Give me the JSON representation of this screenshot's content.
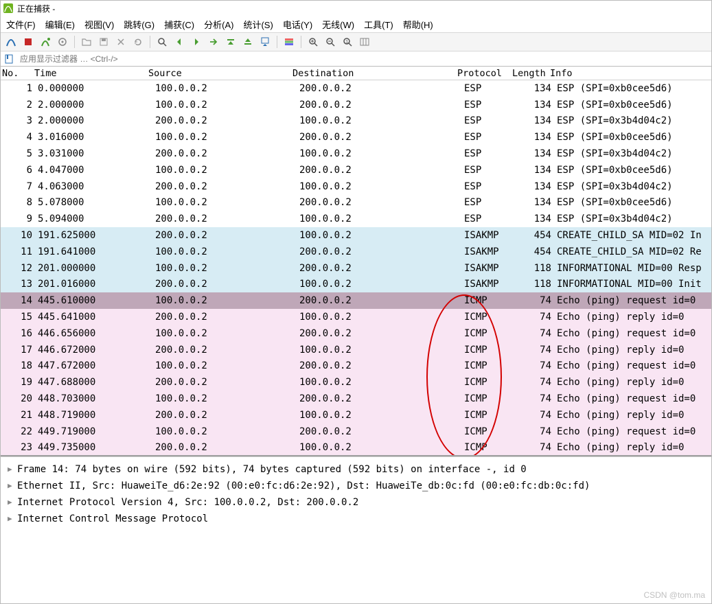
{
  "window": {
    "title": "正在捕获 -"
  },
  "menu": {
    "file": "文件(F)",
    "edit": "编辑(E)",
    "view": "视图(V)",
    "goto": "跳转(G)",
    "capture": "捕获(C)",
    "analyze": "分析(A)",
    "stats": "统计(S)",
    "telephony": "电话(Y)",
    "wireless": "无线(W)",
    "tools": "工具(T)",
    "help": "帮助(H)"
  },
  "filter": {
    "placeholder": "应用显示过滤器 … <Ctrl-/>"
  },
  "columns": {
    "no": "No.",
    "time": "Time",
    "source": "Source",
    "destination": "Destination",
    "protocol": "Protocol",
    "length": "Length",
    "info": "Info"
  },
  "packets": [
    {
      "no": "1",
      "time": "0.000000",
      "src": "100.0.0.2",
      "dst": "200.0.0.2",
      "prot": "ESP",
      "len": "134",
      "info": "ESP (SPI=0xb0cee5d6)",
      "bg": "esp"
    },
    {
      "no": "2",
      "time": "2.000000",
      "src": "100.0.0.2",
      "dst": "200.0.0.2",
      "prot": "ESP",
      "len": "134",
      "info": "ESP (SPI=0xb0cee5d6)",
      "bg": "esp"
    },
    {
      "no": "3",
      "time": "2.000000",
      "src": "200.0.0.2",
      "dst": "100.0.0.2",
      "prot": "ESP",
      "len": "134",
      "info": "ESP (SPI=0x3b4d04c2)",
      "bg": "esp"
    },
    {
      "no": "4",
      "time": "3.016000",
      "src": "100.0.0.2",
      "dst": "200.0.0.2",
      "prot": "ESP",
      "len": "134",
      "info": "ESP (SPI=0xb0cee5d6)",
      "bg": "esp"
    },
    {
      "no": "5",
      "time": "3.031000",
      "src": "200.0.0.2",
      "dst": "100.0.0.2",
      "prot": "ESP",
      "len": "134",
      "info": "ESP (SPI=0x3b4d04c2)",
      "bg": "esp"
    },
    {
      "no": "6",
      "time": "4.047000",
      "src": "100.0.0.2",
      "dst": "200.0.0.2",
      "prot": "ESP",
      "len": "134",
      "info": "ESP (SPI=0xb0cee5d6)",
      "bg": "esp"
    },
    {
      "no": "7",
      "time": "4.063000",
      "src": "200.0.0.2",
      "dst": "100.0.0.2",
      "prot": "ESP",
      "len": "134",
      "info": "ESP (SPI=0x3b4d04c2)",
      "bg": "esp"
    },
    {
      "no": "8",
      "time": "5.078000",
      "src": "100.0.0.2",
      "dst": "200.0.0.2",
      "prot": "ESP",
      "len": "134",
      "info": "ESP (SPI=0xb0cee5d6)",
      "bg": "esp"
    },
    {
      "no": "9",
      "time": "5.094000",
      "src": "200.0.0.2",
      "dst": "100.0.0.2",
      "prot": "ESP",
      "len": "134",
      "info": "ESP (SPI=0x3b4d04c2)",
      "bg": "esp"
    },
    {
      "no": "10",
      "time": "191.625000",
      "src": "200.0.0.2",
      "dst": "100.0.0.2",
      "prot": "ISAKMP",
      "len": "454",
      "info": "CREATE_CHILD_SA MID=02 In",
      "bg": "isakmp"
    },
    {
      "no": "11",
      "time": "191.641000",
      "src": "100.0.0.2",
      "dst": "200.0.0.2",
      "prot": "ISAKMP",
      "len": "454",
      "info": "CREATE_CHILD_SA MID=02 Re",
      "bg": "isakmp"
    },
    {
      "no": "12",
      "time": "201.000000",
      "src": "100.0.0.2",
      "dst": "200.0.0.2",
      "prot": "ISAKMP",
      "len": "118",
      "info": "INFORMATIONAL MID=00 Resp",
      "bg": "isakmp"
    },
    {
      "no": "13",
      "time": "201.016000",
      "src": "200.0.0.2",
      "dst": "100.0.0.2",
      "prot": "ISAKMP",
      "len": "118",
      "info": "INFORMATIONAL MID=00 Init",
      "bg": "isakmp"
    },
    {
      "no": "14",
      "time": "445.610000",
      "src": "100.0.0.2",
      "dst": "200.0.0.2",
      "prot": "ICMP",
      "len": "74",
      "info": "Echo (ping) request  id=0",
      "bg": "icmp",
      "sel": true
    },
    {
      "no": "15",
      "time": "445.641000",
      "src": "200.0.0.2",
      "dst": "100.0.0.2",
      "prot": "ICMP",
      "len": "74",
      "info": "Echo (ping) reply    id=0",
      "bg": "icmp"
    },
    {
      "no": "16",
      "time": "446.656000",
      "src": "100.0.0.2",
      "dst": "200.0.0.2",
      "prot": "ICMP",
      "len": "74",
      "info": "Echo (ping) request  id=0",
      "bg": "icmp"
    },
    {
      "no": "17",
      "time": "446.672000",
      "src": "200.0.0.2",
      "dst": "100.0.0.2",
      "prot": "ICMP",
      "len": "74",
      "info": "Echo (ping) reply    id=0",
      "bg": "icmp"
    },
    {
      "no": "18",
      "time": "447.672000",
      "src": "100.0.0.2",
      "dst": "200.0.0.2",
      "prot": "ICMP",
      "len": "74",
      "info": "Echo (ping) request  id=0",
      "bg": "icmp"
    },
    {
      "no": "19",
      "time": "447.688000",
      "src": "200.0.0.2",
      "dst": "100.0.0.2",
      "prot": "ICMP",
      "len": "74",
      "info": "Echo (ping) reply    id=0",
      "bg": "icmp"
    },
    {
      "no": "20",
      "time": "448.703000",
      "src": "100.0.0.2",
      "dst": "200.0.0.2",
      "prot": "ICMP",
      "len": "74",
      "info": "Echo (ping) request  id=0",
      "bg": "icmp"
    },
    {
      "no": "21",
      "time": "448.719000",
      "src": "200.0.0.2",
      "dst": "100.0.0.2",
      "prot": "ICMP",
      "len": "74",
      "info": "Echo (ping) reply    id=0",
      "bg": "icmp"
    },
    {
      "no": "22",
      "time": "449.719000",
      "src": "100.0.0.2",
      "dst": "200.0.0.2",
      "prot": "ICMP",
      "len": "74",
      "info": "Echo (ping) request  id=0",
      "bg": "icmp"
    },
    {
      "no": "23",
      "time": "449.735000",
      "src": "200.0.0.2",
      "dst": "100.0.0.2",
      "prot": "ICMP",
      "len": "74",
      "info": "Echo (ping) reply    id=0",
      "bg": "icmp"
    }
  ],
  "details": {
    "frame": "Frame 14: 74 bytes on wire (592 bits), 74 bytes captured (592 bits) on interface -, id 0",
    "eth": "Ethernet II, Src: HuaweiTe_d6:2e:92 (00:e0:fc:d6:2e:92), Dst: HuaweiTe_db:0c:fd (00:e0:fc:db:0c:fd)",
    "ip": "Internet Protocol Version 4, Src: 100.0.0.2, Dst: 200.0.0.2",
    "icmp": "Internet Control Message Protocol"
  },
  "watermark": "CSDN @tom.ma"
}
